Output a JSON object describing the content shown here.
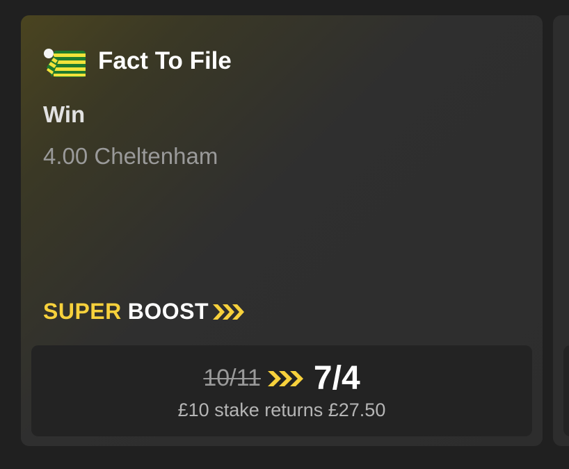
{
  "selection": {
    "runner_name": "Fact To File",
    "market_type": "Win",
    "race_info": "4.00 Cheltenham",
    "silks_icon": "jockey-silks-icon",
    "silks_colors": [
      "#1f7a2e",
      "#f2e33a"
    ]
  },
  "boost": {
    "word1": "SUPER",
    "word2": "BOOST",
    "accent_color": "#f7d13c"
  },
  "odds": {
    "old_price": "10/11",
    "new_price": "7/4",
    "returns_text": "£10 stake returns £27.50"
  }
}
